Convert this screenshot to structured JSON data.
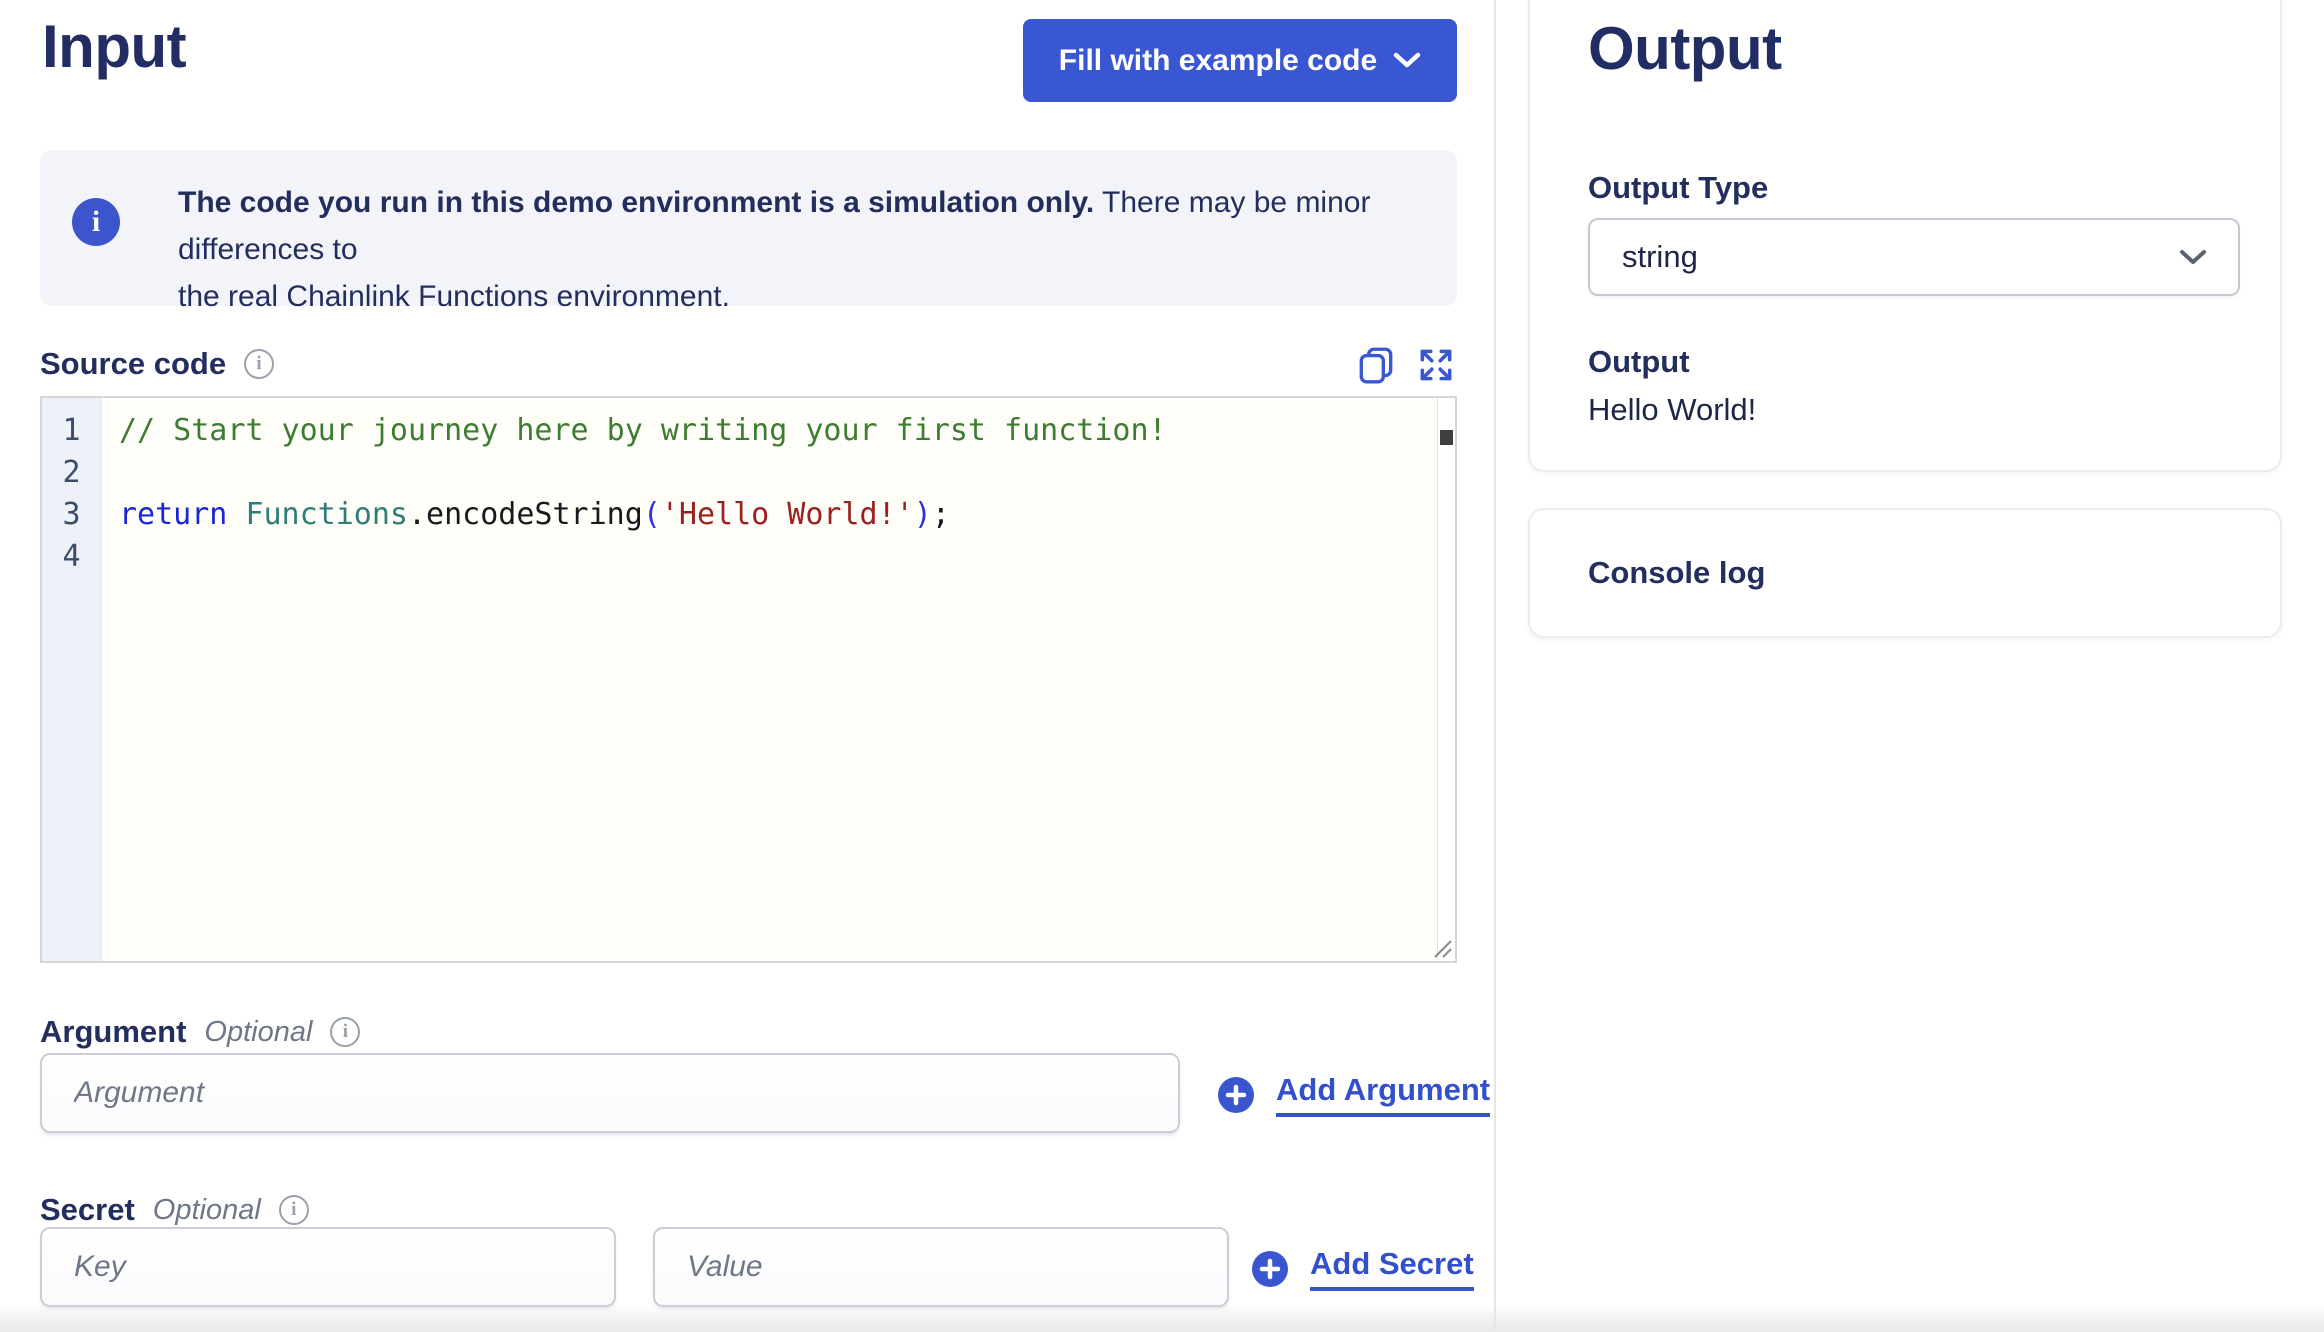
{
  "input_panel": {
    "title": "Input",
    "fill_button_label": "Fill with example code",
    "banner": {
      "bold": "The code you run in this demo environment is a simulation only.",
      "rest": " There may be minor differences to",
      "line2": "the real Chainlink Functions environment."
    },
    "source_code": {
      "label": "Source code",
      "lines": [
        {
          "num": "1",
          "tokens": [
            {
              "t": "// Start your journey here by writing your first function!",
              "c": "comment"
            }
          ]
        },
        {
          "num": "2",
          "tokens": []
        },
        {
          "num": "3",
          "tokens": [
            {
              "t": "return",
              "c": "keyword"
            },
            {
              "t": " ",
              "c": "plain"
            },
            {
              "t": "Functions",
              "c": "type"
            },
            {
              "t": ".encodeString",
              "c": "plain"
            },
            {
              "t": "(",
              "c": "paren"
            },
            {
              "t": "'Hello World!'",
              "c": "string"
            },
            {
              "t": ")",
              "c": "paren"
            },
            {
              "t": ";",
              "c": "plain"
            }
          ]
        },
        {
          "num": "4",
          "tokens": []
        }
      ]
    },
    "argument": {
      "label": "Argument",
      "optional": "Optional",
      "placeholder": "Argument",
      "add_label": "Add Argument"
    },
    "secret": {
      "label": "Secret",
      "optional": "Optional",
      "key_placeholder": "Key",
      "value_placeholder": "Value",
      "add_label": "Add Secret"
    }
  },
  "output_panel": {
    "title": "Output",
    "output_type_label": "Output Type",
    "output_type_value": "string",
    "output_label": "Output",
    "output_value": "Hello World!",
    "console_label": "Console log"
  },
  "info_glyph": "i",
  "colors": {
    "brand_blue": "#3a57d2",
    "link_blue": "#3350cb",
    "heading_navy": "#222d63",
    "banner_bg": "#f2f4fa",
    "comment_green": "#3c7d32",
    "keyword_blue": "#1a25d6",
    "type_teal": "#2e7e76",
    "string_red": "#9a2121"
  }
}
